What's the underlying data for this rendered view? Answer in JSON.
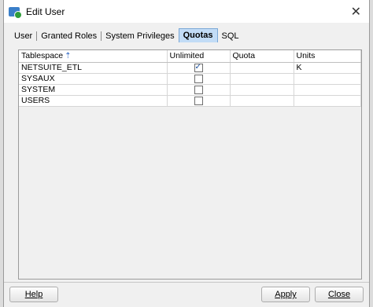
{
  "window": {
    "title": "Edit User"
  },
  "tabs": [
    {
      "label": "User",
      "active": false
    },
    {
      "label": "Granted Roles",
      "active": false
    },
    {
      "label": "System Privileges",
      "active": false
    },
    {
      "label": "Quotas",
      "active": true
    },
    {
      "label": "SQL",
      "active": false
    }
  ],
  "table": {
    "columns": [
      "Tablespace",
      "Unlimited",
      "Quota",
      "Units"
    ],
    "sort_icon": "sort-ascending-icon",
    "rows": [
      {
        "tablespace": "NETSUITE_ETL",
        "unlimited": true,
        "quota": "",
        "units": "K"
      },
      {
        "tablespace": "SYSAUX",
        "unlimited": false,
        "quota": "",
        "units": ""
      },
      {
        "tablespace": "SYSTEM",
        "unlimited": false,
        "quota": "",
        "units": ""
      },
      {
        "tablespace": "USERS",
        "unlimited": false,
        "quota": "",
        "units": ""
      }
    ]
  },
  "buttons": {
    "help": "Help",
    "apply": "Apply",
    "close": "Close"
  }
}
